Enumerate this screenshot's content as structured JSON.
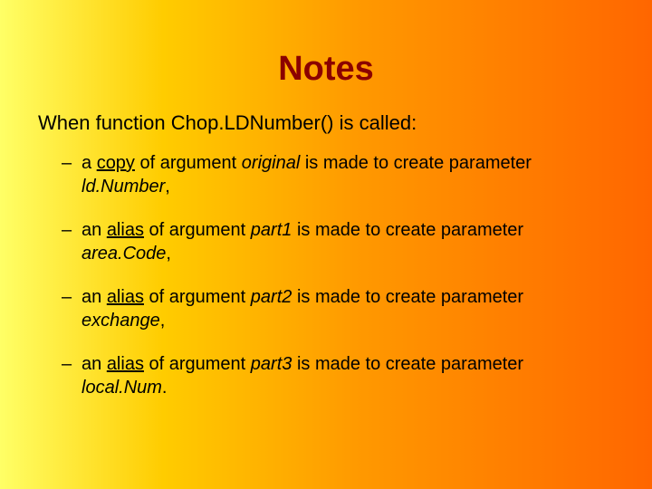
{
  "title": "Notes",
  "intro": "When function Chop.LDNumber() is called:",
  "bullets": [
    {
      "pre": "a ",
      "u": "copy",
      "mid": " of argument ",
      "arg": "original",
      "mid2": " is made to create parameter ",
      "param": "ld.Number",
      "end": ","
    },
    {
      "pre": "an ",
      "u": "alias",
      "mid": " of argument ",
      "arg": "part1",
      "mid2": " is made to create parameter ",
      "param": "area.Code",
      "end": ","
    },
    {
      "pre": "an ",
      "u": "alias",
      "mid": " of argument ",
      "arg": "part2",
      "mid2": " is made to create parameter ",
      "param": "exchange",
      "end": ","
    },
    {
      "pre": "an ",
      "u": "alias",
      "mid": " of argument ",
      "arg": "part3",
      "mid2": " is made to create parameter ",
      "param": "local.Num",
      "end": "."
    }
  ]
}
